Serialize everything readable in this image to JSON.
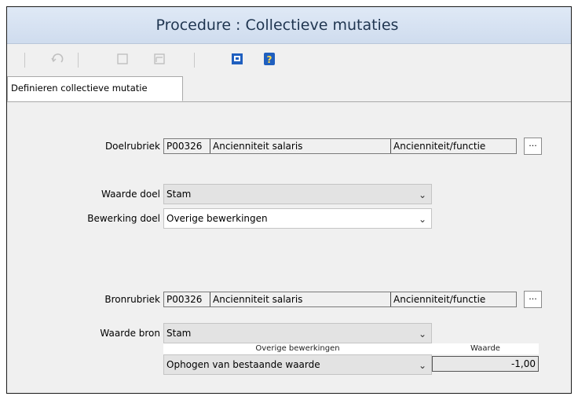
{
  "window": {
    "title": "Procedure : Collectieve mutaties"
  },
  "toolbar": {
    "buttons": [
      {
        "icon": "undo-icon"
      },
      {
        "icon": "checkbox-icon"
      },
      {
        "icon": "form-icon"
      },
      {
        "icon": "save-icon",
        "color": "#1f5fbf"
      },
      {
        "icon": "help-icon",
        "color": "#1f5fbf"
      }
    ]
  },
  "tabs": [
    {
      "label": "Definieren collectieve mutatie",
      "active": true
    }
  ],
  "form": {
    "doelrubriek": {
      "label": "Doelrubriek",
      "code": "P00326",
      "name": "Ancienniteit salaris",
      "type": "Ancienniteit/functie",
      "browse_label": "..."
    },
    "waarde_doel": {
      "label": "Waarde doel",
      "value": "Stam"
    },
    "bewerking_doel": {
      "label": "Bewerking doel",
      "value": "Overige bewerkingen"
    },
    "bronrubriek": {
      "label": "Bronrubriek",
      "code": "P00326",
      "name": "Ancienniteit salaris",
      "type": "Ancienniteit/functie",
      "browse_label": "..."
    },
    "waarde_bron": {
      "label": "Waarde bron",
      "value": "Stam"
    },
    "bewerkingen_table": {
      "headers": [
        "Overige bewerkingen",
        "Waarde"
      ],
      "row": {
        "operation": "Ophogen van bestaande waarde",
        "waarde": "-1,00"
      }
    }
  },
  "colors": {
    "title_text": "#1f3550",
    "titlebar_bg": "#d6e2f1",
    "panel_bg": "#f0f0f0",
    "icon_blue": "#1f5fbf"
  }
}
